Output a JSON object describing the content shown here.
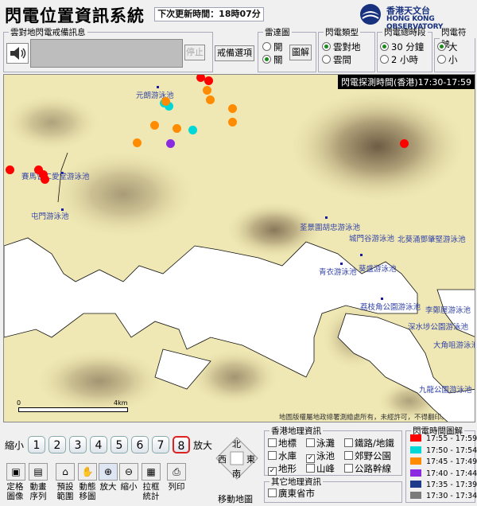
{
  "app_title": "閃電位置資訊系統",
  "update_text": "下次更新時間：18時07分",
  "logo": {
    "zh": "香港天文台",
    "en": "HONG KONG OBSERVATORY"
  },
  "alert_panel": {
    "legend": "雲對地閃電戒備訊息",
    "stop_label": "停止",
    "options_button": "戒備選項"
  },
  "radar_panel": {
    "legend": "雷達圖",
    "options": [
      "開",
      "關"
    ],
    "selected": 1,
    "legend_button": "圖解"
  },
  "lightning_type": {
    "legend": "閃電類型",
    "options": [
      "雲對地",
      "雲間"
    ],
    "selected": 0
  },
  "lightning_period": {
    "legend": "閃電總時段",
    "options": [
      "30 分鐘",
      "2 小時"
    ],
    "selected": 0
  },
  "lightning_symbol": {
    "legend": "閃電符號",
    "options": [
      "大",
      "小"
    ],
    "selected": 0
  },
  "map": {
    "time_label": "閃電探測時間(香港)17:30-17:59",
    "scale_start": "0",
    "scale_end": "4km",
    "copyright": "地圖版權屬地政總署測繪處所有，未經許可，不得翻印。",
    "pools": [
      "元朗游泳池",
      "賽馬會仁愛堂游泳池",
      "屯門游泳池",
      "荃景圍胡忠游泳池",
      "城門谷游泳池",
      "北葵涌鄧肇堅游泳池",
      "葵盛游泳池",
      "青衣游泳池",
      "荔枝角公園游泳池",
      "李鄭屋游泳池",
      "深水埗公園游泳池",
      "大角咀游泳池",
      "九龍公園游泳池"
    ]
  },
  "zoom": {
    "shrink_label": "縮小",
    "enlarge_label": "放大",
    "levels": [
      "1",
      "2",
      "3",
      "4",
      "5",
      "6",
      "7",
      "8"
    ],
    "selected": "8"
  },
  "tools": [
    {
      "label": "定格\n圖像",
      "icon": "still-image-icon"
    },
    {
      "label": "動畫\n序列",
      "icon": "film-icon"
    },
    {
      "label": "預設\n範圍",
      "icon": "home-icon"
    },
    {
      "label": "動態\n移圖",
      "icon": "hand-icon"
    },
    {
      "label": "放大",
      "icon": "zoom-in-icon"
    },
    {
      "label": "縮小",
      "icon": "zoom-out-icon"
    },
    {
      "label": "拉框\n統計",
      "icon": "box-stats-icon"
    },
    {
      "label": "列印",
      "icon": "printer-icon"
    }
  ],
  "compass": {
    "north": "北",
    "south": "南",
    "east": "東",
    "west": "西",
    "label": "移動地圖"
  },
  "geo_panel": {
    "legend": "香港地理資訊",
    "items": [
      {
        "label": "地標",
        "checked": false
      },
      {
        "label": "泳灘",
        "checked": false
      },
      {
        "label": "鐵路/地鐵",
        "checked": false
      },
      {
        "label": "水庫",
        "checked": false
      },
      {
        "label": "泳池",
        "checked": true
      },
      {
        "label": "郊野公園",
        "checked": false
      },
      {
        "label": "地形",
        "checked": true
      },
      {
        "label": "山峰",
        "checked": false
      },
      {
        "label": "公路幹線",
        "checked": false
      }
    ]
  },
  "other_panel": {
    "legend": "其它地理資訊",
    "items": [
      {
        "label": "廣東省市",
        "checked": false
      }
    ]
  },
  "time_legend": {
    "legend": "閃電時間圖解",
    "rows": [
      {
        "label": "17:55 - 17:59",
        "color": "#ff0000"
      },
      {
        "label": "17:50 - 17:54",
        "color": "#00d8d8"
      },
      {
        "label": "17:45 - 17:49",
        "color": "#ff8c00"
      },
      {
        "label": "17:40 - 17:44",
        "color": "#8a2be2"
      },
      {
        "label": "17:35 - 17:39",
        "color": "#1e3a8a"
      },
      {
        "label": "17:30 - 17:34",
        "color": "#7a7a7a"
      }
    ]
  },
  "strike_colors": {
    "red": "#ff0000",
    "orange": "#ff8c00",
    "cyan": "#00d8d8",
    "purple": "#8a2be2"
  }
}
